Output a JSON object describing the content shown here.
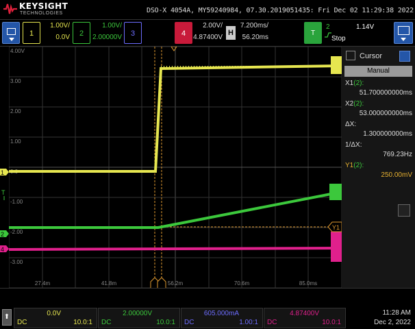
{
  "title_bar": {
    "brand_name": "KEYSIGHT",
    "brand_sub": "TECHNOLOGIES",
    "scope_title": "DSO-X 4054A, MY59240984, 07.30.2019051435: Fri Dec 02 11:29:38 2022"
  },
  "channels": [
    {
      "num": "1",
      "scale": "1.00V/",
      "offset": "0.0V",
      "color": "#e6e650"
    },
    {
      "num": "2",
      "scale": "1.00V/",
      "offset": "2.00000V",
      "color": "#3cc83c"
    },
    {
      "num": "3",
      "scale": "",
      "offset": "",
      "color": "#6d6dff"
    },
    {
      "num": "4",
      "scale": "2.00V/",
      "offset": "4.87400V",
      "color": "#c81a3a"
    }
  ],
  "horizontal": {
    "label": "H",
    "timebase": "7.200ms/",
    "position": "56.20ms"
  },
  "trigger": {
    "label": "T",
    "source": "2",
    "level": "1.14V",
    "mode": "Stop"
  },
  "graticule": {
    "left_markers": {
      "ch1": "1",
      "trigger": "T",
      "ch2": "2",
      "ch4": "4"
    },
    "y_labels": [
      "4.00V",
      "3.00",
      "2.00",
      "1.00",
      "0.0",
      "-1.00",
      "-2.00",
      "-3.00"
    ],
    "x_labels": [
      "27.4m",
      "41.8m",
      "56.2m",
      "70.6m",
      "85.0ms"
    ],
    "cursor_tags": {
      "x1": "X1",
      "x2": "X2",
      "y1": "Y1"
    }
  },
  "cursor_panel": {
    "title": "Cursor",
    "mode": "Manual",
    "readouts": [
      {
        "label": "X1",
        "src": "(2):",
        "value": "51.700000000ms",
        "style": "normal"
      },
      {
        "label": "X2",
        "src": "(2):",
        "value": "53.000000000ms",
        "style": "normal"
      },
      {
        "label": "ΔX:",
        "src": "",
        "value": "1.300000000ms",
        "style": "normal"
      },
      {
        "label": "1/ΔX:",
        "src": "",
        "value": "769.23Hz",
        "style": "normal"
      },
      {
        "label": "Y1",
        "src": "(2):",
        "value": "250.00mV",
        "style": "yellow"
      }
    ]
  },
  "bottom_bar": {
    "home_icon": "home-icon",
    "cells": [
      {
        "name": "ch1",
        "top": "0.0V",
        "coupling": "DC",
        "probe": "10.0:1",
        "color": "#e6e650"
      },
      {
        "name": "ch2",
        "top": "2.00000V",
        "coupling": "DC",
        "probe": "10.0:1",
        "color": "#3cc83c"
      },
      {
        "name": "ch3",
        "top": "605.000mA",
        "coupling": "DC",
        "probe": "1.00:1",
        "color": "#6d6dff"
      },
      {
        "name": "ch4",
        "top": "4.87400V",
        "coupling": "DC",
        "probe": "10.0:1",
        "color": "#e0208c"
      }
    ],
    "clock_time": "11:28 AM",
    "clock_date": "Dec 2, 2022"
  }
}
